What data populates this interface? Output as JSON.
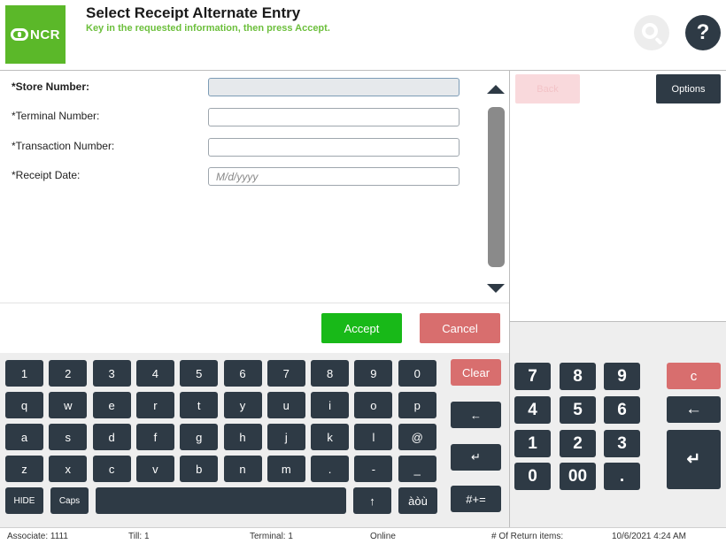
{
  "header": {
    "logo_text": "NCR",
    "title": "Select Receipt Alternate Entry",
    "subtitle": "Key in the requested information, then press Accept.",
    "help_label": "?"
  },
  "form": {
    "fields": [
      {
        "label": "*Store Number:",
        "value": "",
        "placeholder": ""
      },
      {
        "label": "*Terminal Number:",
        "value": "",
        "placeholder": ""
      },
      {
        "label": "*Transaction Number:",
        "value": "",
        "placeholder": ""
      },
      {
        "label": "*Receipt Date:",
        "value": "",
        "placeholder": "M/d/yyyy"
      }
    ],
    "accept_label": "Accept",
    "cancel_label": "Cancel"
  },
  "right_panel": {
    "back_label": "Back",
    "options_label": "Options"
  },
  "keyboard": {
    "rows": [
      [
        "1",
        "2",
        "3",
        "4",
        "5",
        "6",
        "7",
        "8",
        "9",
        "0"
      ],
      [
        "q",
        "w",
        "e",
        "r",
        "t",
        "y",
        "u",
        "i",
        "o",
        "p"
      ],
      [
        "a",
        "s",
        "d",
        "f",
        "g",
        "h",
        "j",
        "k",
        "l",
        "@"
      ],
      [
        "z",
        "x",
        "c",
        "v",
        "b",
        "n",
        "m",
        ".",
        "-",
        "_"
      ]
    ],
    "hide_label": "HIDE",
    "caps_label": "Caps",
    "space_label": "",
    "shift_label": "↑",
    "accent_label": "àòù",
    "clear_label": "Clear",
    "backspace_label": "←",
    "enter_label": "↵",
    "symbols_label": "#+="
  },
  "numpad": {
    "rows": [
      [
        "7",
        "8",
        "9"
      ],
      [
        "4",
        "5",
        "6"
      ],
      [
        "1",
        "2",
        "3"
      ],
      [
        "0",
        "00",
        "."
      ]
    ],
    "clear_label": "c",
    "backspace_label": "←",
    "enter_label": "↵"
  },
  "status_bar": {
    "associate": "Associate: 1111",
    "till": "Till: 1",
    "terminal": "Terminal: 1",
    "connection": "Online",
    "return_items": "# Of Return items:",
    "datetime": "10/6/2021 4:24 AM"
  },
  "colors": {
    "dark_key": "#2e3a45",
    "accept_green": "#18b918",
    "cancel_red": "#d86e6e",
    "brand_green": "#5bb829",
    "subtitle_green": "#6cbf3c"
  }
}
